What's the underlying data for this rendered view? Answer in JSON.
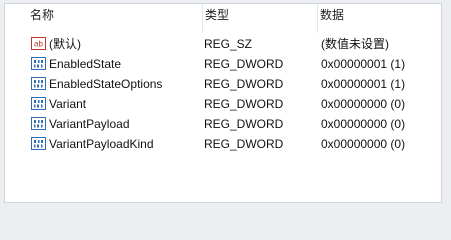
{
  "columns": {
    "name": "名称",
    "type": "类型",
    "data": "数据"
  },
  "rows": [
    {
      "icon": "string-value-icon",
      "name": "(默认)",
      "type": "REG_SZ",
      "data": "(数值未设置)"
    },
    {
      "icon": "binary-value-icon",
      "name": "EnabledState",
      "type": "REG_DWORD",
      "data": "0x00000001 (1)"
    },
    {
      "icon": "binary-value-icon",
      "name": "EnabledStateOptions",
      "type": "REG_DWORD",
      "data": "0x00000001 (1)"
    },
    {
      "icon": "binary-value-icon",
      "name": "Variant",
      "type": "REG_DWORD",
      "data": "0x00000000 (0)"
    },
    {
      "icon": "binary-value-icon",
      "name": "VariantPayload",
      "type": "REG_DWORD",
      "data": "0x00000000 (0)"
    },
    {
      "icon": "binary-value-icon",
      "name": "VariantPayloadKind",
      "type": "REG_DWORD",
      "data": "0x00000000 (0)"
    }
  ],
  "icon_labels": {
    "string": "ab"
  },
  "colors": {
    "string_icon": "#c0392b",
    "binary_icon": "#2f6fb0"
  }
}
